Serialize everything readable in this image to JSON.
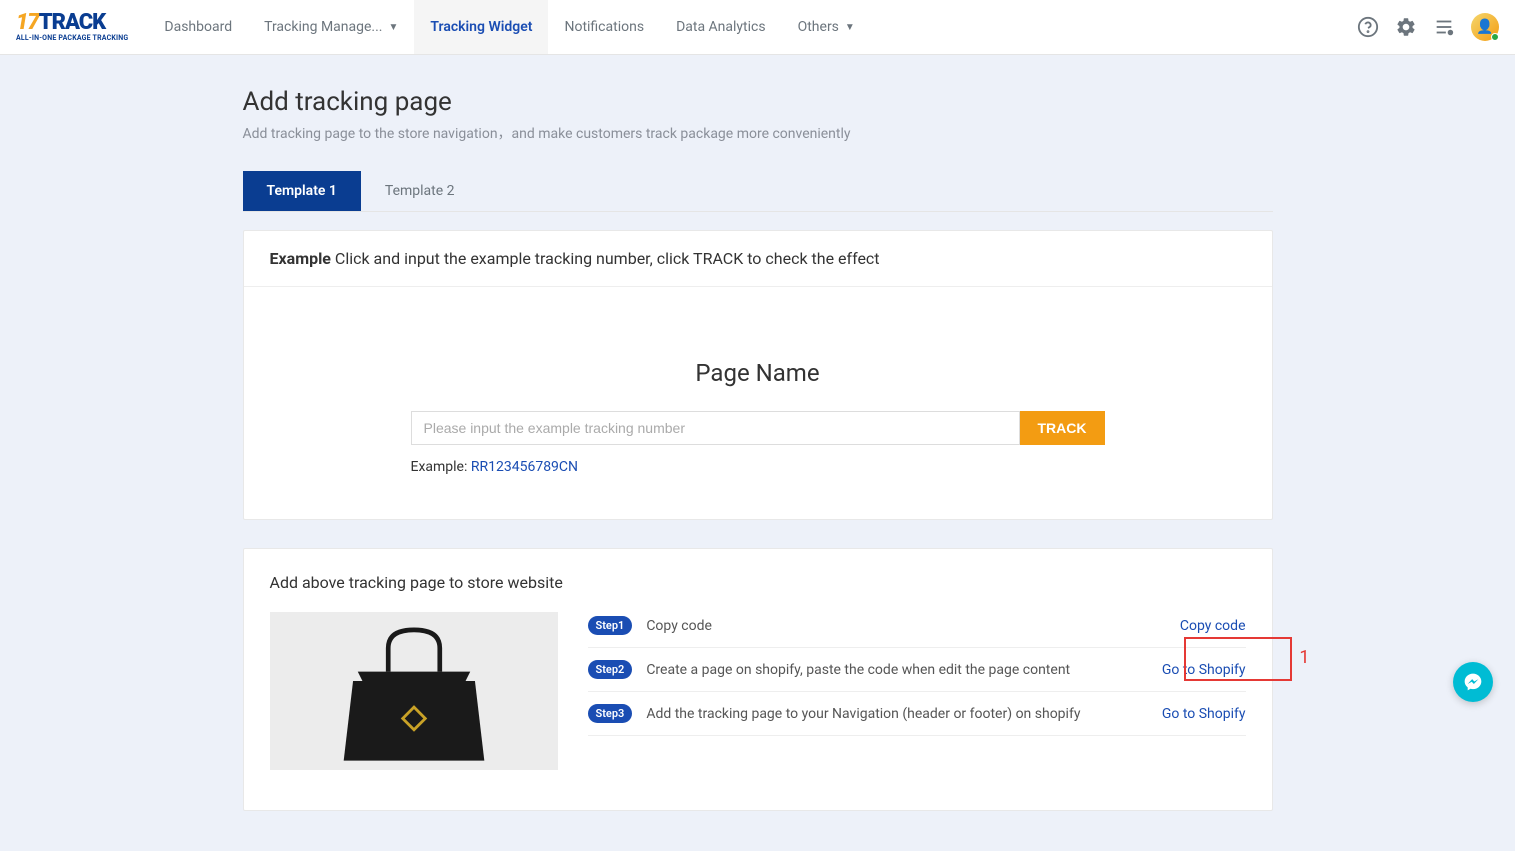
{
  "header": {
    "logo_main_17": "17",
    "logo_main_track": "TRACK",
    "logo_sub": "ALL-IN-ONE PACKAGE TRACKING",
    "nav": [
      {
        "label": "Dashboard"
      },
      {
        "label": "Tracking Manage..."
      },
      {
        "label": "Tracking Widget"
      },
      {
        "label": "Notifications"
      },
      {
        "label": "Data Analytics"
      },
      {
        "label": "Others"
      }
    ]
  },
  "page": {
    "title": "Add tracking page",
    "subtitle": "Add tracking page to the store navigation，and make customers track package more conveniently"
  },
  "tabs": [
    {
      "label": "Template 1"
    },
    {
      "label": "Template 2"
    }
  ],
  "example": {
    "strong": "Example",
    "text": " Click and input the example tracking number, click TRACK to check the effect",
    "page_name": "Page Name",
    "placeholder": "Please input the example tracking number",
    "button": "TRACK",
    "example_label": "Example: ",
    "example_num": "RR123456789CN"
  },
  "steps": {
    "title": "Add above tracking page to store website",
    "rows": [
      {
        "badge": "Step1",
        "text": "Copy code",
        "link": "Copy code"
      },
      {
        "badge": "Step2",
        "text": "Create a page on shopify, paste the code when edit the page content",
        "link": "Go to Shopify"
      },
      {
        "badge": "Step3",
        "text": "Add the tracking page to your Navigation (header or footer) on shopify",
        "link": "Go to Shopify"
      }
    ]
  },
  "annotation": {
    "num": "1"
  }
}
